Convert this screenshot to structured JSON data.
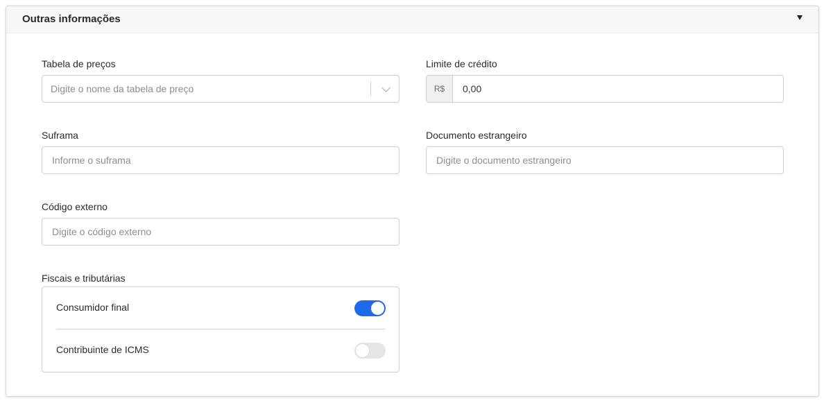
{
  "panel": {
    "title": "Outras informações",
    "collapse_icon": "caret-down-icon"
  },
  "fields": {
    "price_table": {
      "label": "Tabela de preços",
      "placeholder": "Digite o nome da tabela de preço",
      "value": ""
    },
    "credit_limit": {
      "label": "Limite de crédito",
      "prefix": "R$",
      "value": "0,00"
    },
    "suframa": {
      "label": "Suframa",
      "placeholder": "Informe o suframa",
      "value": ""
    },
    "foreign_document": {
      "label": "Documento estrangeiro",
      "placeholder": "Digite o documento estrangeiro",
      "value": ""
    },
    "external_code": {
      "label": "Código externo",
      "placeholder": "Digite o código externo",
      "value": ""
    }
  },
  "tax": {
    "label": "Fiscais e tributárias",
    "options": [
      {
        "label": "Consumidor final",
        "checked": true
      },
      {
        "label": "Contribuinte de ICMS",
        "checked": false
      }
    ]
  },
  "colors": {
    "toggle_on": "#1f6ae8",
    "toggle_off": "#e6e6e6"
  }
}
